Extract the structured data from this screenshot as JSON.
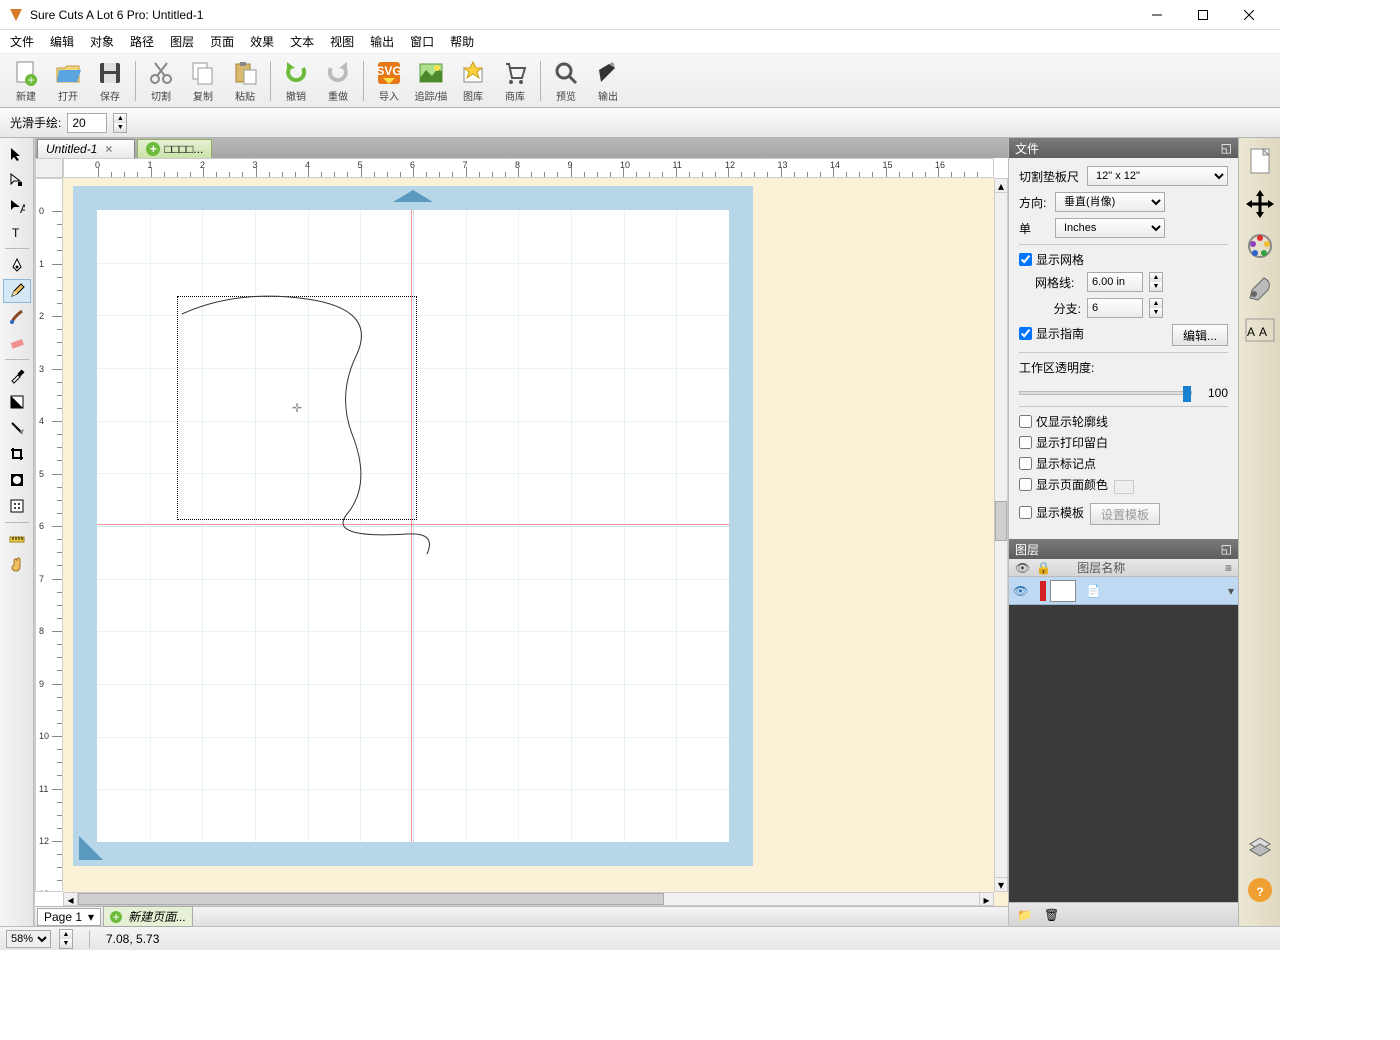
{
  "window": {
    "title": "Sure Cuts A Lot 6 Pro: Untitled-1"
  },
  "menu": [
    "文件",
    "编辑",
    "对象",
    "路径",
    "图层",
    "页面",
    "效果",
    "文本",
    "视图",
    "输出",
    "窗口",
    "帮助"
  ],
  "toolbar": [
    {
      "label": "新建"
    },
    {
      "label": "打开"
    },
    {
      "label": "保存"
    },
    {
      "sep": true
    },
    {
      "label": "切割"
    },
    {
      "label": "复制"
    },
    {
      "label": "粘贴"
    },
    {
      "sep": true
    },
    {
      "label": "撤销"
    },
    {
      "label": "重做"
    },
    {
      "sep": true
    },
    {
      "label": "导入"
    },
    {
      "label": "追踪/描"
    },
    {
      "label": "图库"
    },
    {
      "label": "商库"
    },
    {
      "sep": true
    },
    {
      "label": "预览"
    },
    {
      "label": "输出"
    }
  ],
  "optionbar": {
    "label": "光滑手绘:",
    "value": "20"
  },
  "tabs": {
    "active": "Untitled-1",
    "newlabel": "□□□□..."
  },
  "ruler_major": [
    0,
    1,
    2,
    3,
    4,
    5,
    6,
    7,
    8,
    9,
    10,
    11,
    12,
    13,
    14,
    15,
    16
  ],
  "doc_panel": {
    "title": "文件",
    "matsize_label": "切割垫板尺",
    "matsize": "12\" x 12\"",
    "orient_label": "方向:",
    "orient": "垂直(肖像)",
    "unit_label": "单",
    "unit": "Inches",
    "showgrid": "显示网格",
    "grid_label": "网格线:",
    "grid": "6.00 in",
    "subdiv_label": "分支:",
    "subdiv": "6",
    "showguide": "显示指南",
    "editbtn": "编辑...",
    "opacity_label": "工作区透明度:",
    "opacity_val": "100",
    "outline": "仅显示轮廓线",
    "printmargin": "显示打印留白",
    "regmark": "显示标记点",
    "pagecolor": "显示页面颜色",
    "template": "显示模板",
    "settemplate": "设置模板"
  },
  "layers": {
    "title": "图层",
    "col": "图层名称"
  },
  "pagebar": {
    "page": "Page 1",
    "newpage": "新建页面..."
  },
  "status": {
    "zoom": "58%",
    "coords": "7.08, 5.73"
  }
}
